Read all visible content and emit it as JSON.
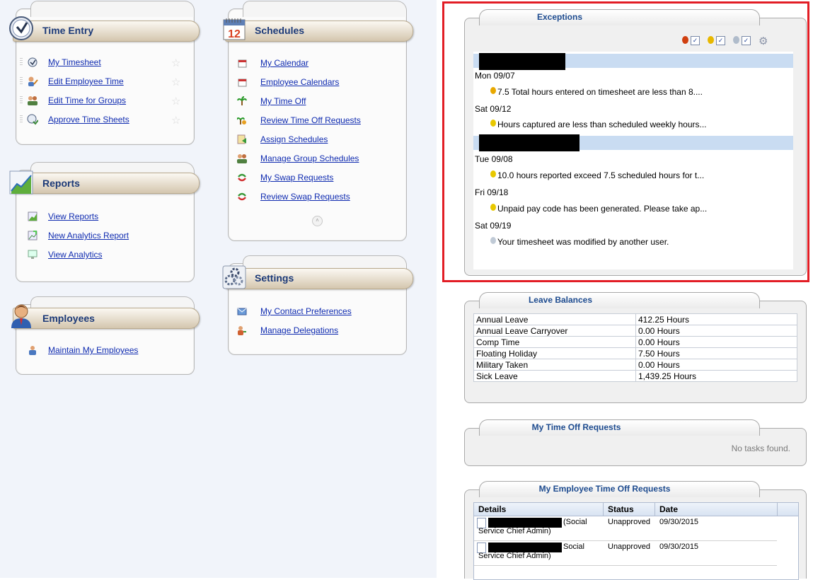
{
  "time_entry": {
    "title": "Time Entry",
    "items": [
      {
        "label": "My Timesheet",
        "icon": "clock-icon"
      },
      {
        "label": "Edit Employee Time",
        "icon": "user-edit-icon"
      },
      {
        "label": "Edit Time for Groups",
        "icon": "group-icon"
      },
      {
        "label": "Approve Time Sheets",
        "icon": "clock-check-icon"
      }
    ]
  },
  "reports": {
    "title": "Reports",
    "items": [
      {
        "label": "View Reports"
      },
      {
        "label": "New Analytics Report"
      },
      {
        "label": "View Analytics"
      }
    ]
  },
  "employees": {
    "title": "Employees",
    "items": [
      {
        "label": "Maintain My Employees"
      }
    ]
  },
  "schedules": {
    "title": "Schedules",
    "icon_number": "12",
    "items": [
      {
        "label": "My Calendar"
      },
      {
        "label": "Employee Calendars"
      },
      {
        "label": "My Time Off"
      },
      {
        "label": "Review Time Off Requests"
      },
      {
        "label": "Assign Schedules"
      },
      {
        "label": "Manage Group Schedules"
      },
      {
        "label": "My Swap Requests"
      },
      {
        "label": "Review Swap Requests"
      }
    ]
  },
  "settings": {
    "title": "Settings",
    "items": [
      {
        "label": "My Contact Preferences"
      },
      {
        "label": "Manage Delegations"
      }
    ]
  },
  "exceptions": {
    "title": "Exceptions",
    "groups": [
      {
        "entries": [
          {
            "date": "Mon 09/07",
            "message": "7.5 Total hours entered on timesheet are less than 8....",
            "pin_color": "#e8a800"
          },
          {
            "date": "Sat 09/12",
            "message": "Hours captured are less than scheduled weekly hours...",
            "pin_color": "#e8c800"
          }
        ]
      },
      {
        "entries": [
          {
            "date": "Tue 09/08",
            "message": "10.0 hours reported exceed 7.5 scheduled hours for t...",
            "pin_color": "#e8c800"
          },
          {
            "date": "Fri 09/18",
            "message": "Unpaid pay code has been generated. Please take ap...",
            "pin_color": "#e8c800"
          },
          {
            "date": "Sat 09/19",
            "message": "Your timesheet was modified by another user.",
            "pin_color": "#b8c4d0"
          }
        ]
      }
    ]
  },
  "leave_balances": {
    "title": "Leave Balances",
    "rows": [
      {
        "type": "Annual Leave",
        "balance": "412.25 Hours"
      },
      {
        "type": "Annual Leave Carryover",
        "balance": "0.00 Hours"
      },
      {
        "type": "Comp Time",
        "balance": "0.00 Hours"
      },
      {
        "type": "Floating Holiday",
        "balance": "7.50 Hours"
      },
      {
        "type": "Military Taken",
        "balance": "0.00 Hours"
      },
      {
        "type": "Sick Leave",
        "balance": "1,439.25 Hours"
      }
    ]
  },
  "my_time_off": {
    "title": "My Time Off Requests",
    "empty_text": "No tasks found."
  },
  "employee_time_off": {
    "title": "My Employee Time Off Requests",
    "columns": [
      "Details",
      "Status",
      "Date"
    ],
    "rows": [
      {
        "details_line1": "(Social",
        "details_line2": "Service Chief Admin)",
        "status": "Unapproved",
        "date": "09/30/2015"
      },
      {
        "details_line1": "Social",
        "details_line2": "Service Chief Admin)",
        "status": "Unapproved",
        "date": "09/30/2015"
      }
    ]
  },
  "colors": {
    "link": "#0f2bb0",
    "header_text": "#1c3a78",
    "highlight_frame": "#e21d25"
  }
}
